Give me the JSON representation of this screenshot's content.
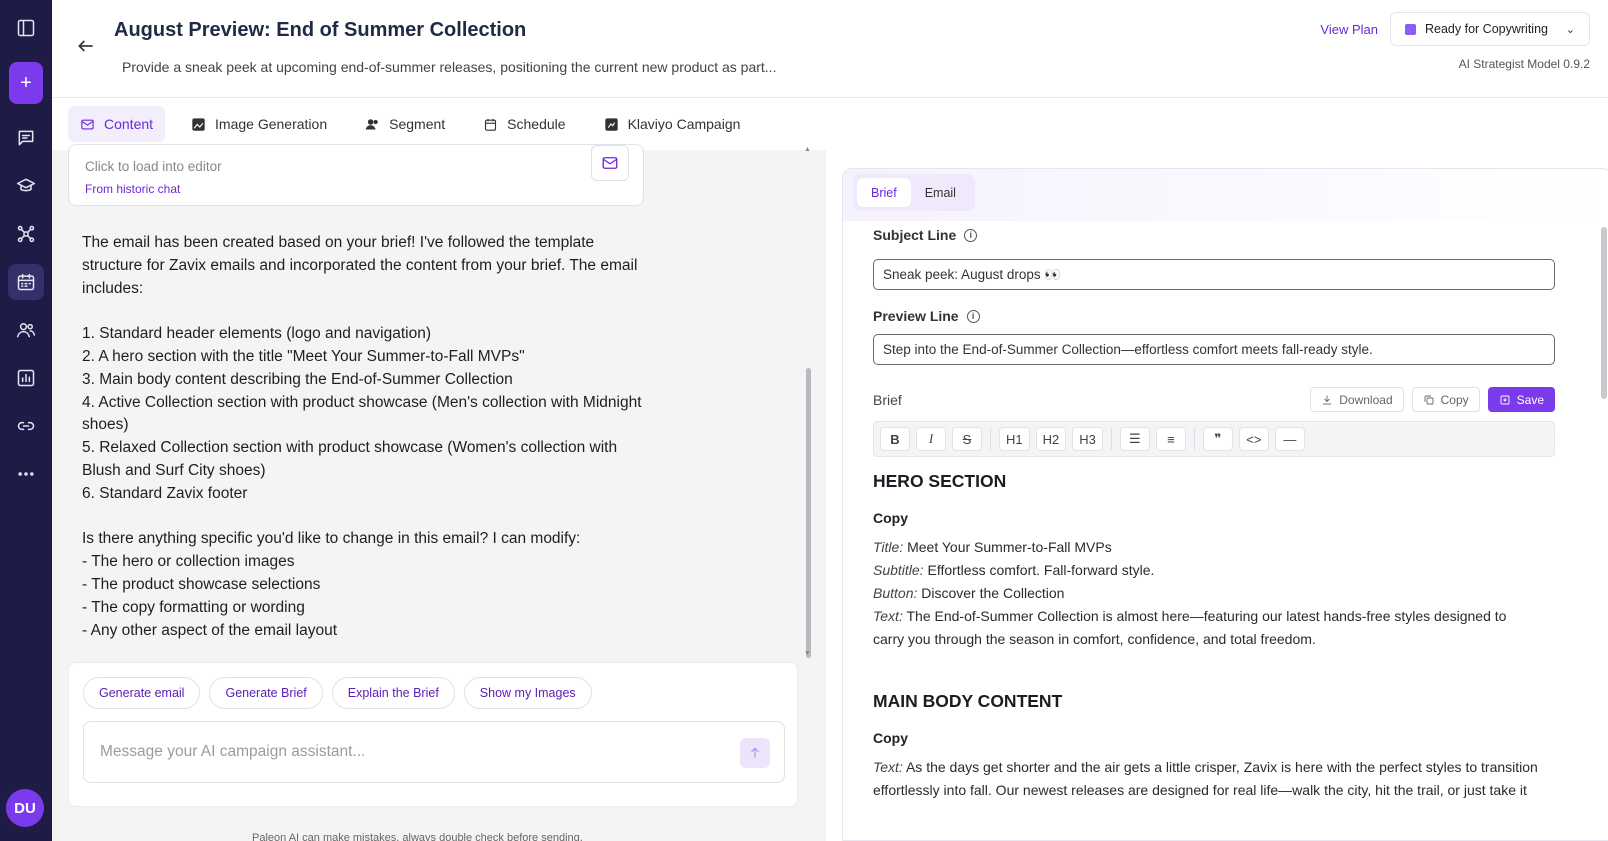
{
  "colors": {
    "accent": "#7c3aed",
    "sidebar_bg": "#1f1b47",
    "link": "#6d28d9"
  },
  "sidebar": {
    "items": [
      {
        "icon": "sidebar-toggle-icon"
      },
      {
        "icon": "plus-icon",
        "label": "+"
      },
      {
        "icon": "chat-icon"
      },
      {
        "icon": "graduation-cap-icon"
      },
      {
        "icon": "network-icon"
      },
      {
        "icon": "calendar-icon"
      },
      {
        "icon": "users-icon"
      },
      {
        "icon": "chart-icon"
      },
      {
        "icon": "link-icon"
      },
      {
        "icon": "more-icon"
      }
    ],
    "avatar": "DU"
  },
  "header": {
    "title": "August Preview: End of Summer Collection",
    "subtitle": "Provide a sneak peek at upcoming end-of-summer releases, positioning the current new product as part...",
    "view_plan": "View Plan",
    "status": "Ready for Copywriting",
    "model_version": "AI Strategist Model 0.9.2"
  },
  "tabs": [
    {
      "label": "Content",
      "icon": "mail-icon",
      "active": true
    },
    {
      "label": "Image Generation",
      "icon": "image-icon"
    },
    {
      "label": "Segment",
      "icon": "users-icon"
    },
    {
      "label": "Schedule",
      "icon": "calendar-icon"
    },
    {
      "label": "Klaviyo Campaign",
      "icon": "klaviyo-icon"
    }
  ],
  "chat": {
    "history_card": {
      "load_text": "Click to load into editor",
      "from_text": "From historic chat"
    },
    "message": [
      "The email has been created based on your brief! I've followed the template structure for Zavix emails and incorporated the content from your brief. The email includes:",
      "",
      "1. Standard header elements (logo and navigation)",
      "2. A hero section with the title \"Meet Your Summer-to-Fall MVPs\"",
      "3. Main body content describing the End-of-Summer Collection",
      "4. Active Collection section with product showcase (Men's collection with Midnight shoes)",
      "5. Relaxed Collection section with product showcase (Women's collection with Blush and Surf City shoes)",
      "6. Standard Zavix footer",
      "",
      "Is there anything specific you'd like to change in this email? I can modify:",
      "- The hero or collection images",
      "- The product showcase selections",
      "- The copy formatting or wording",
      "- Any other aspect of the email layout"
    ],
    "chips": [
      "Generate email",
      "Generate Brief",
      "Explain the Brief",
      "Show my Images"
    ],
    "input_placeholder": "Message your AI campaign assistant...",
    "disclaimer": "Paleon AI can make mistakes, always double check before sending."
  },
  "editor": {
    "tabs": [
      {
        "label": "Brief",
        "active": true
      },
      {
        "label": "Email"
      }
    ],
    "subject_label": "Subject Line",
    "subject_value": "Sneak peek: August drops 👀",
    "preview_label": "Preview Line",
    "preview_value": "Step into the End-of-Summer Collection—effortless comfort meets fall-ready style.",
    "brief_label": "Brief",
    "actions": {
      "download": "Download",
      "copy": "Copy",
      "save": "Save"
    },
    "toolbar": [
      "B",
      "I",
      "S",
      "H1",
      "H2",
      "H3",
      "bullet-list-icon",
      "numbered-list-icon",
      "quote-icon",
      "code-icon",
      "divider-icon"
    ],
    "content": {
      "hero_heading": "HERO SECTION",
      "hero_copy_label": "Copy",
      "hero_title_label": "Title:",
      "hero_title": "Meet Your Summer-to-Fall MVPs",
      "hero_subtitle_label": "Subtitle:",
      "hero_subtitle": "Effortless comfort. Fall-forward style.",
      "hero_button_label": "Button:",
      "hero_button": "Discover the Collection",
      "hero_text_label": "Text:",
      "hero_text_1": "The End-of-Summer Collection is almost here—featuring our latest hands-free styles designed to",
      "hero_text_2": "carry you through the season in comfort, confidence, and total freedom.",
      "main_heading": "MAIN BODY CONTENT",
      "main_copy_label": "Copy",
      "main_text_label": "Text:",
      "main_text_1": "As the days get shorter and the air gets a little crisper, Zavix is here with the perfect styles to transition",
      "main_text_2": "effortlessly into fall. Our newest releases are designed for real life—walk the city, hit the trail, or just take it"
    }
  }
}
